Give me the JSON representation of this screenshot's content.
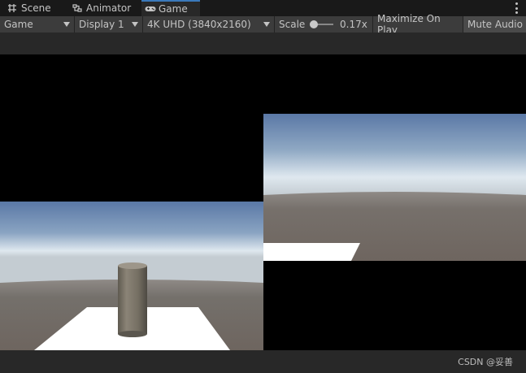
{
  "tabs": [
    {
      "label": "Scene",
      "icon": "grid-icon"
    },
    {
      "label": "Animator",
      "icon": "animator-icon"
    },
    {
      "label": "Game",
      "icon": "gamepad-icon",
      "active": true
    }
  ],
  "toolbar": {
    "view_mode": "Game",
    "display": "Display 1",
    "resolution": "4K UHD (3840x2160)",
    "scale_label": "Scale",
    "scale_value": "0.17x",
    "maximize_on_play": "Maximize On Play",
    "mute_audio": "Mute Audio"
  },
  "colors": {
    "sky_top": "#5a78a6",
    "sky_horizon": "#dfe8ef",
    "ground": "#6e655f",
    "plane": "#ffffff",
    "active_tab_accent": "#3a79bb"
  },
  "watermark": "CSDN @妥善"
}
